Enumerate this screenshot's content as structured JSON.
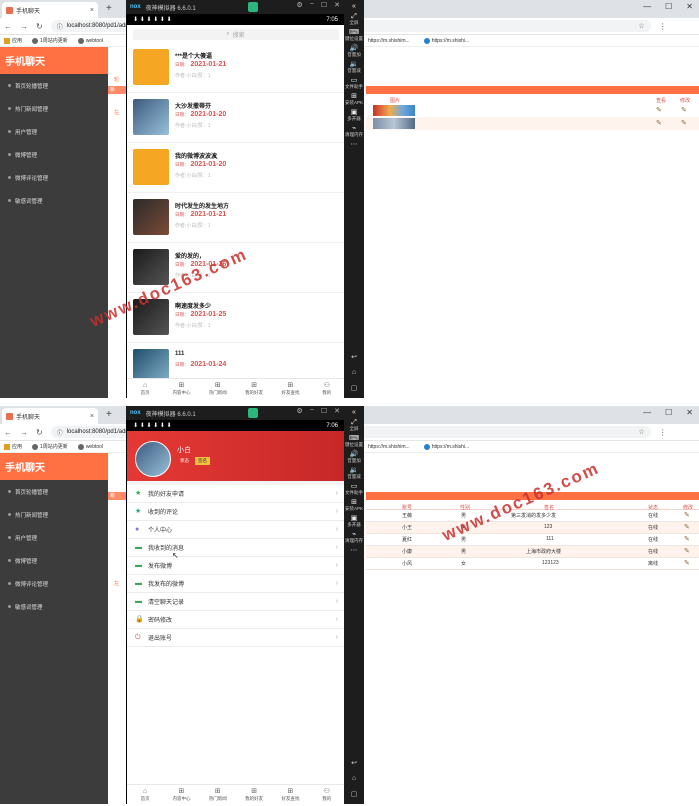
{
  "browser": {
    "tab_title": "手机聊天",
    "url": "localhost:8080/pd1/adm",
    "bookmarks": [
      "应用",
      "1周站内更新",
      "webtool",
      "https://m.shishim...",
      "https://m.shishi..."
    ]
  },
  "admin": {
    "logo": "手机聊天",
    "sidebar": [
      "首页轮播管理",
      "热门新闻管理",
      "用户管理",
      "微博管理",
      "微博评论管理",
      "敏感词管理"
    ],
    "crumb": "轮",
    "panel_tag": "新",
    "side_note": "左",
    "news_table": {
      "headers": [
        "图片",
        "查看",
        "修改"
      ]
    },
    "user_table": {
      "headers": [
        "账号",
        "性别",
        "签名",
        "状态",
        "修改"
      ],
      "rows": [
        [
          "王薇",
          "男",
          "第三发消的发多少发",
          "在线"
        ],
        [
          "小王",
          "男",
          "123",
          "在线"
        ],
        [
          "夏红",
          "男",
          "111",
          "在线"
        ],
        [
          "小康",
          "男",
          "上海市政府大楼",
          "在线"
        ],
        [
          "小风",
          "女",
          "123123",
          "离线"
        ]
      ]
    }
  },
  "emulator": {
    "brand": "nox",
    "title": "夜神模拟器 6.6.0.1",
    "side_buttons": [
      "全屏",
      "键位设置",
      "音量加",
      "音量减",
      "文件助手",
      "安装APK",
      "多开器",
      "清理内存"
    ],
    "time1": "7:05",
    "time2": "7:06"
  },
  "phone1": {
    "search_placeholder": "搜索",
    "date_label": "日期：",
    "news": [
      {
        "title": "***是个大傻逼",
        "date": "2021-01-21",
        "author": "作者:小白|赞：1"
      },
      {
        "title": "大沙发撒蒂芬",
        "date": "2021-01-20",
        "author": "作者:小白|赞：1"
      },
      {
        "title": "我的微博波波波",
        "date": "2021-01-20",
        "author": "作者:小白|赞：1"
      },
      {
        "title": "时代发生的发生地方",
        "date": "2021-01-21",
        "author": "作者:小白|赞：1"
      },
      {
        "title": "爱的发的，",
        "date": "2021-01-26",
        "author": "作者:小白|赞：1"
      },
      {
        "title": "啊速度发多少",
        "date": "2021-01-25",
        "author": "作者:小白|赞：1"
      },
      {
        "title": "111",
        "date": "2021-01-24",
        "author": ""
      }
    ]
  },
  "bottom_nav": [
    "首页",
    "内容中心",
    "热门新闻",
    "我的好友",
    "好友查找",
    "我的"
  ],
  "phone2": {
    "user_name": "小白",
    "tag1": "状态",
    "tag2": "签名",
    "menu": [
      "我的好友申请",
      "收到的评论",
      "个人中心",
      "我收到的消息",
      "发布微博",
      "我发布的微博",
      "清空聊天记录",
      "密码修改",
      "退出账号"
    ]
  },
  "watermark": "www.doc163.com"
}
